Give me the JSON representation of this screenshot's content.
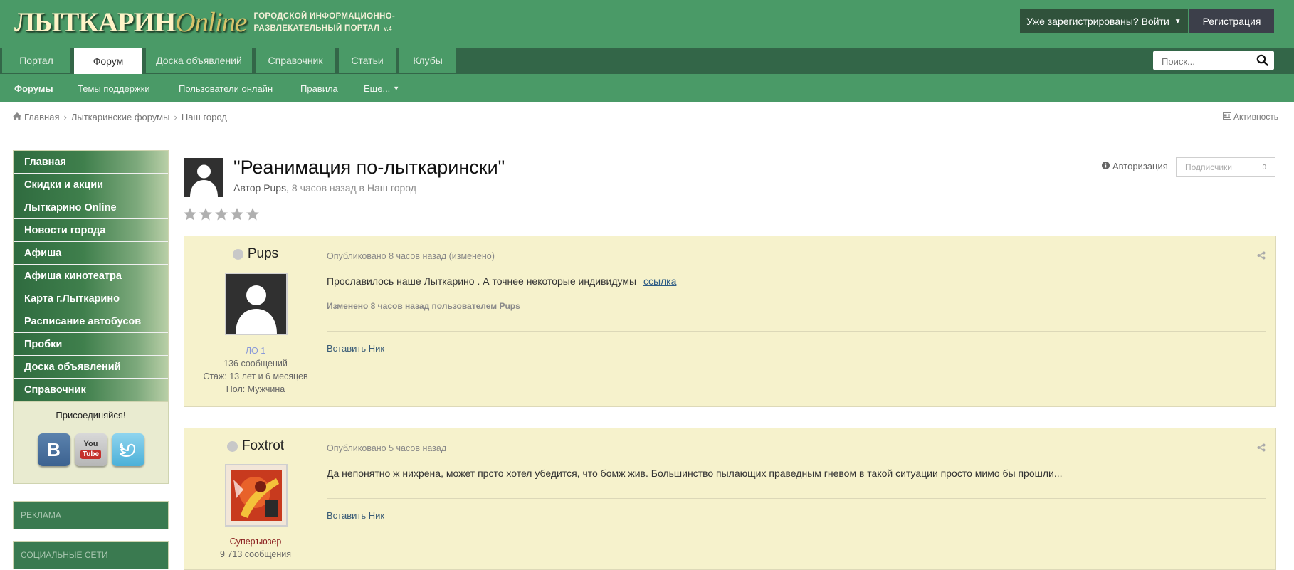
{
  "header": {
    "logo_main": "ЛЫТКАРИН",
    "logo_online": "Online",
    "tagline_line1": "ГОРОДСКОЙ ИНФОРМАЦИОННО-",
    "tagline_line2": "РАЗВЛЕКАТЕЛЬНЫЙ ПОРТАЛ",
    "version": "v.4",
    "signin_label": "Уже зарегистрированы? Войти",
    "register_label": "Регистрация",
    "colors": {
      "header_bg": "#4a9a67",
      "nav_bg": "#336648",
      "register_bg": "#3c3f4a"
    }
  },
  "topnav": {
    "tabs": [
      "Портал",
      "Форум",
      "Доска объявлений",
      "Справочник",
      "Статьи",
      "Клубы"
    ],
    "active": "Форум"
  },
  "search": {
    "placeholder": "Поиск..."
  },
  "subnav": {
    "items": [
      "Форумы",
      "Темы поддержки",
      "Пользователи онлайн",
      "Правила",
      "Еще..."
    ]
  },
  "breadcrumb": {
    "items": [
      "Главная",
      "Лыткаринские форумы",
      "Наш город"
    ],
    "activity": "Активность"
  },
  "sidebar": {
    "menu": [
      "Главная",
      "Скидки и акции",
      "Лыткарино Online",
      "Новости города",
      "Афиша",
      "Афиша кинотеатра",
      "Карта г.Лыткарино",
      "Расписание автобусов",
      "Пробки",
      "Доска объявлений",
      "Справочник"
    ],
    "join_title": "Присоединяйся!",
    "social": [
      "vk",
      "youtube",
      "twitter"
    ],
    "blocks": [
      "РЕКЛАМА",
      "СОЦИАЛЬНЫЕ СЕТИ"
    ]
  },
  "topic": {
    "title": "\"Реанимация по-лыткарински\"",
    "author_prefix": "Автор",
    "author": "Pups",
    "time": "8 часов назад",
    "in_word": "в",
    "forum": "Наш город",
    "rating_stars": 5,
    "auth_label": "Авторизация",
    "follow_label": "Подписчики",
    "follow_count": "0"
  },
  "posts": [
    {
      "author": "Pups",
      "rank": "ЛО 1",
      "rank_color": "#8a9ad8",
      "posts_count": "136 сообщений",
      "tenure": "Стаж: 13 лет и 6 месяцев",
      "gender": "Пол: Мужчина",
      "date": "Опубликовано 8 часов назад (изменено)",
      "text": "Прославилось наше Лыткарино . А точнее некоторые индивидумы",
      "link": "ссылка",
      "edited": "Изменено 8 часов назад пользователем Pups",
      "quote": "Вставить Ник"
    },
    {
      "author": "Foxtrot",
      "rank": "Суперъюзер",
      "rank_color": "#8a1f1f",
      "posts_count": "9 713 сообщения",
      "date": "Опубликовано 5 часов назад",
      "text": "Да непонятно ж нихрена,  может прсто хотел убедится,  что бомж жив. Большинство пылающих праведным гневом в такой ситуации просто мимо бы прошли...",
      "quote": "Вставить Ник"
    }
  ]
}
